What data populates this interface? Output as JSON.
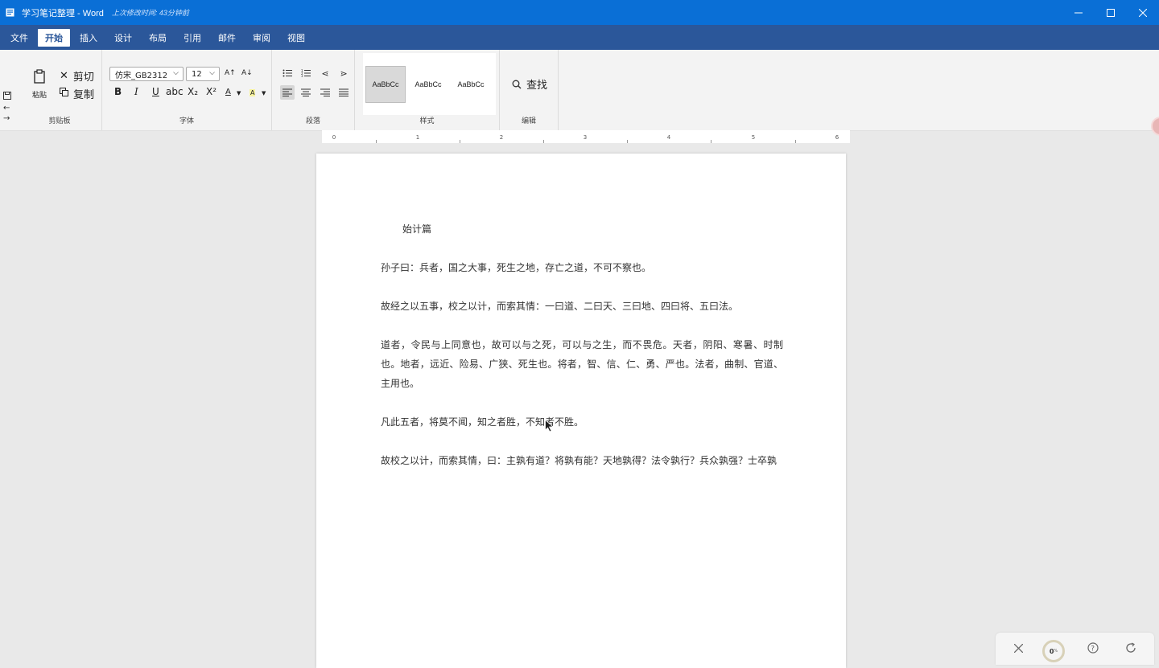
{
  "titlebar": {
    "title": "学习笔记整理 - Word",
    "saved_status": "上次修改时间: 43分钟前"
  },
  "menu": {
    "tabs": [
      {
        "label": "文件"
      },
      {
        "label": "开始"
      },
      {
        "label": "插入"
      },
      {
        "label": "设计"
      },
      {
        "label": "布局"
      },
      {
        "label": "引用"
      },
      {
        "label": "邮件"
      },
      {
        "label": "审阅"
      },
      {
        "label": "视图"
      }
    ],
    "active": "开始"
  },
  "ribbon": {
    "clipboard": {
      "paste": "粘贴",
      "cut": "剪切",
      "copy": "复制",
      "label": "剪贴板"
    },
    "font": {
      "name": "仿宋_GB2312",
      "size": "12",
      "grow": "A↑",
      "shrink": "A↓",
      "bold": "B",
      "italic": "I",
      "underline": "U",
      "strike": "abc",
      "subscript": "X₂",
      "superscript": "X²",
      "font_color": "A",
      "highlight": "A",
      "label": "字体"
    },
    "paragraph": {
      "label": "段落"
    },
    "styles": {
      "samples": [
        "AaBbCc",
        "AaBbCc",
        "AaBbCc"
      ],
      "label": "样式"
    },
    "editing": {
      "find": "查找",
      "label": "编辑"
    }
  },
  "ruler": {
    "marks": [
      "0",
      "1",
      "2",
      "3",
      "4",
      "5",
      "6"
    ]
  },
  "document": {
    "title": "始计篇",
    "paragraphs": [
      "孙子曰：兵者，国之大事，死生之地，存亡之道，不可不察也。",
      "故经之以五事，校之以计，而索其情：一曰道、二曰天、三曰地、四曰将、五曰法。",
      "道者，令民与上同意也，故可以与之死，可以与之生，而不畏危。天者，阴阳、寒暑、时制也。地者，远近、险易、广狭、死生也。将者，智、信、仁、勇、严也。法者，曲制、官道、主用也。",
      "凡此五者，将莫不闻，知之者胜，不知者不胜。",
      "故校之以计，而索其情，曰：主孰有道？将孰有能？天地孰得？法令孰行？兵众孰强？士卒孰"
    ]
  },
  "widget": {
    "progress": "0",
    "unit": "%"
  }
}
